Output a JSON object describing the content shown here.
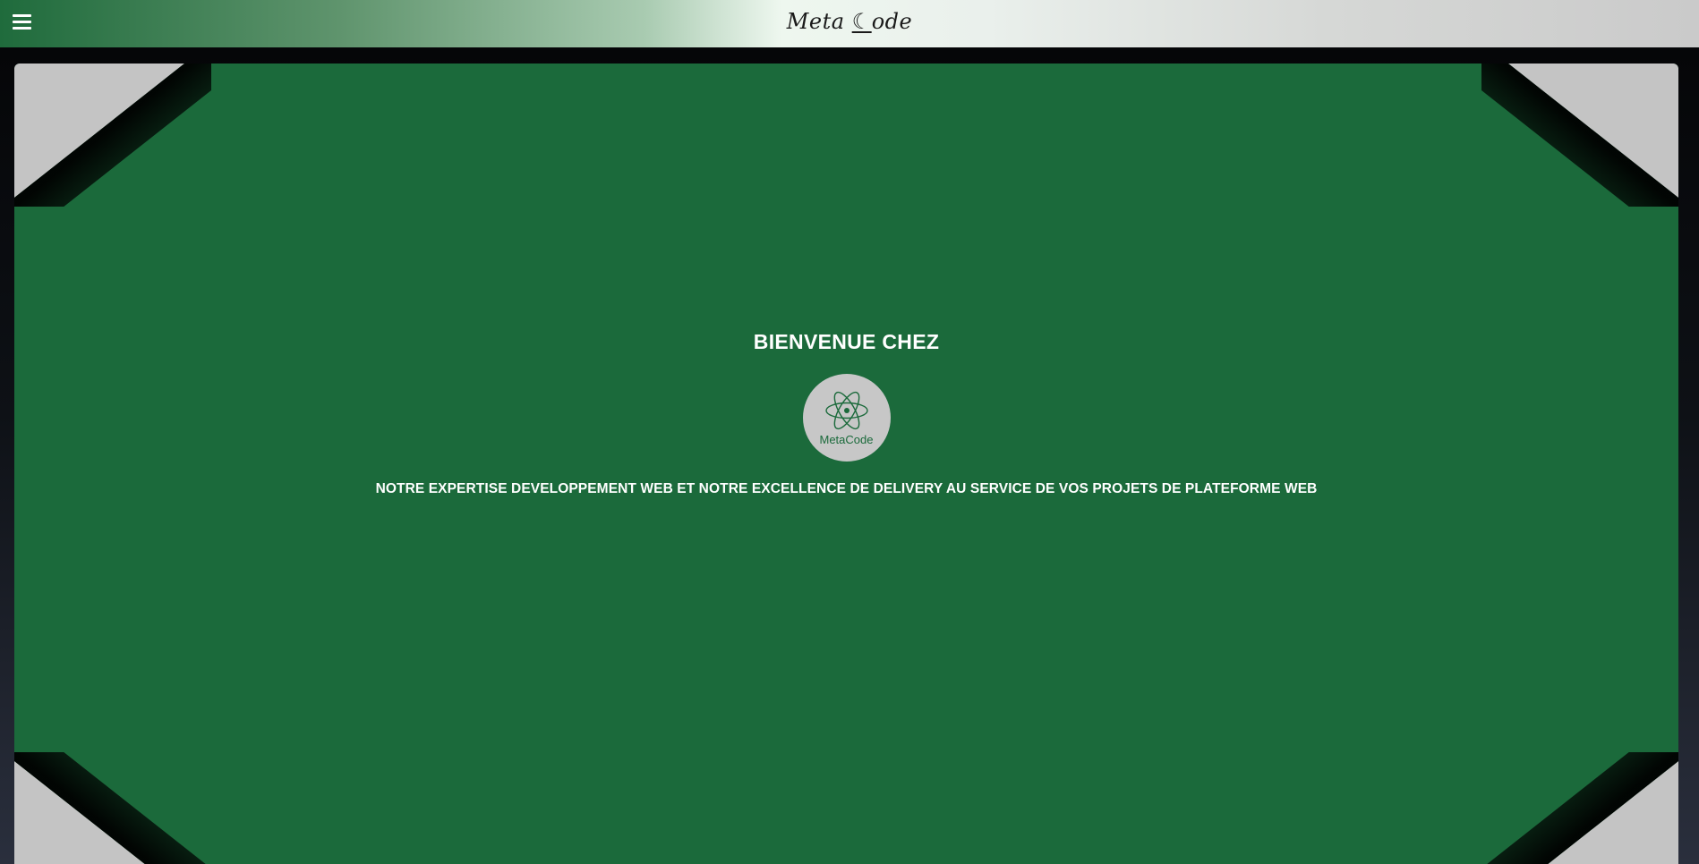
{
  "header": {
    "brand_prefix": "Meta",
    "brand_moon": "☾",
    "brand_suffix": "ode",
    "menu_icon": "hamburger-menu-icon"
  },
  "hero": {
    "welcome": "BIENVENUE CHEZ",
    "logo_text": "MetaCode",
    "logo_icon": "atom-icon",
    "tagline": "NOTRE EXPERTISE DEVELOPPEMENT WEB ET NOTRE EXCELLENCE DE DELIVERY AU SERVICE DE VOS PROJETS DE PLATEFORME WEB"
  },
  "colors": {
    "primary_green": "#1b6a3b",
    "logo_bg": "#c7c7c7",
    "corner_gray": "#c4c4c4"
  }
}
